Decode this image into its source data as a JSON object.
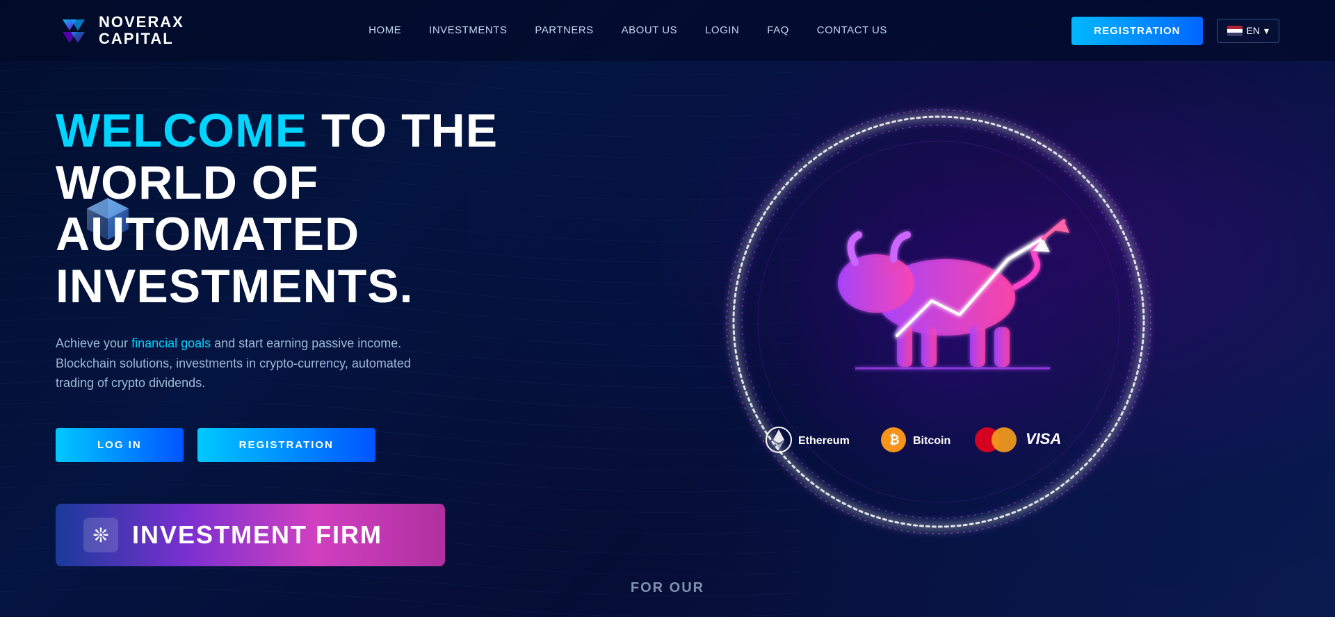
{
  "brand": {
    "name_line1": "NOVERAX",
    "name_line2": "CAPITAL"
  },
  "nav": {
    "links": [
      {
        "label": "HOME",
        "id": "home"
      },
      {
        "label": "INVESTMENTS",
        "id": "investments"
      },
      {
        "label": "PARTNERS",
        "id": "partners"
      },
      {
        "label": "ABOUT US",
        "id": "about"
      },
      {
        "label": "LOGIN",
        "id": "login"
      },
      {
        "label": "FAQ",
        "id": "faq"
      },
      {
        "label": "CONTACT US",
        "id": "contact"
      }
    ],
    "registration_btn": "REGISTRATION",
    "lang_code": "EN"
  },
  "hero": {
    "title_highlight": "WELCOME",
    "title_rest": " TO THE WORLD OF AUTOMATED INVESTMENTS.",
    "desc_normal": "Achieve your ",
    "desc_link": "financial goals",
    "desc_after": " and start earning passive income.",
    "desc_sub": "Blockchain solutions, investments in crypto-currency, automated trading of crypto dividends.",
    "btn_login": "LOG IN",
    "btn_register": "REGISTRATION"
  },
  "banner": {
    "icon": "❊",
    "text_normal": "INVESTMENT ",
    "text_bold": "FIRM"
  },
  "payments": {
    "ethereum_label": "Ethereum",
    "bitcoin_label": "Bitcoin",
    "visa_label": "VISA"
  },
  "bottom": {
    "text": "FOR OUR"
  }
}
